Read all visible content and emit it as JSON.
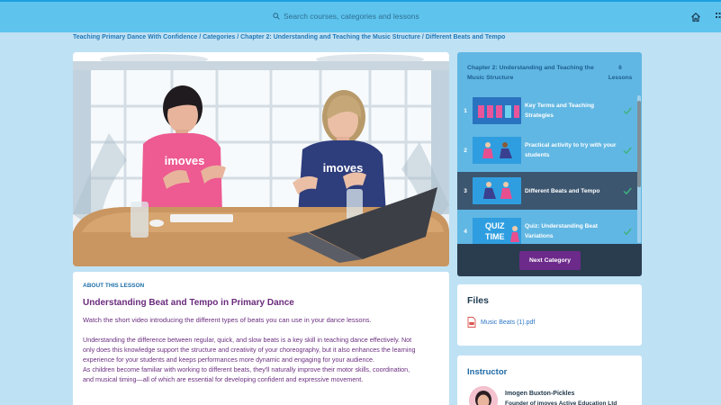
{
  "header": {
    "search_placeholder": "Search courses, categories and lessons"
  },
  "breadcrumb": {
    "text": "Teaching Primary Dance With Confidence / Categories / Chapter 2: Understanding and Teaching the Music Structure / Different Beats and Tempo"
  },
  "video": {
    "shirt_text": "imoves"
  },
  "about": {
    "label": "ABOUT THIS LESSON",
    "title": "Understanding Beat and Tempo in Primary Dance",
    "intro": "Watch the short video introducing the different types of beats you can use in your dance lessons.",
    "body_lines": [
      "Understanding the difference between regular, quick, and slow beats is a key skill in teaching dance effectively. Not",
      "only does this knowledge support the structure and creativity of your choreography, but it also enhances the learning",
      "experience for your students and keeps performances more dynamic and engaging for your audience.",
      "As children become familiar with working to different beats, they'll naturally improve their motor skills, coordination,",
      "and musical timing—all of which are essential for developing confident and expressive movement."
    ]
  },
  "chapter": {
    "title": "Chapter 2: Understanding and Teaching the Music Structure",
    "count_number": "6",
    "count_label": "Lessons",
    "lessons": [
      {
        "num": "1",
        "title": "Key Terms and Teaching Strategies",
        "completed": true,
        "active": false
      },
      {
        "num": "2",
        "title": "Practical activity to try with your students",
        "completed": true,
        "active": false
      },
      {
        "num": "3",
        "title": "Different Beats and Tempo",
        "completed": true,
        "active": true
      },
      {
        "num": "4",
        "title": "Quiz: Understanding Beat Variations",
        "completed": true,
        "active": false
      }
    ],
    "quiz_thumb_top": "QUIZ",
    "quiz_thumb_bottom": "TIME",
    "next_label": "Next Category"
  },
  "files": {
    "heading": "Files",
    "items": [
      {
        "name": "Music Beats (1).pdf"
      }
    ]
  },
  "instructor": {
    "heading": "Instructor",
    "name": "Imogen Buxton-Pickles",
    "role": "Founder of imoves Active Education Ltd"
  },
  "colors": {
    "accent_purple": "#6c2a8a",
    "topbar": "#5ec4ee",
    "check_green": "#3fb27f"
  }
}
